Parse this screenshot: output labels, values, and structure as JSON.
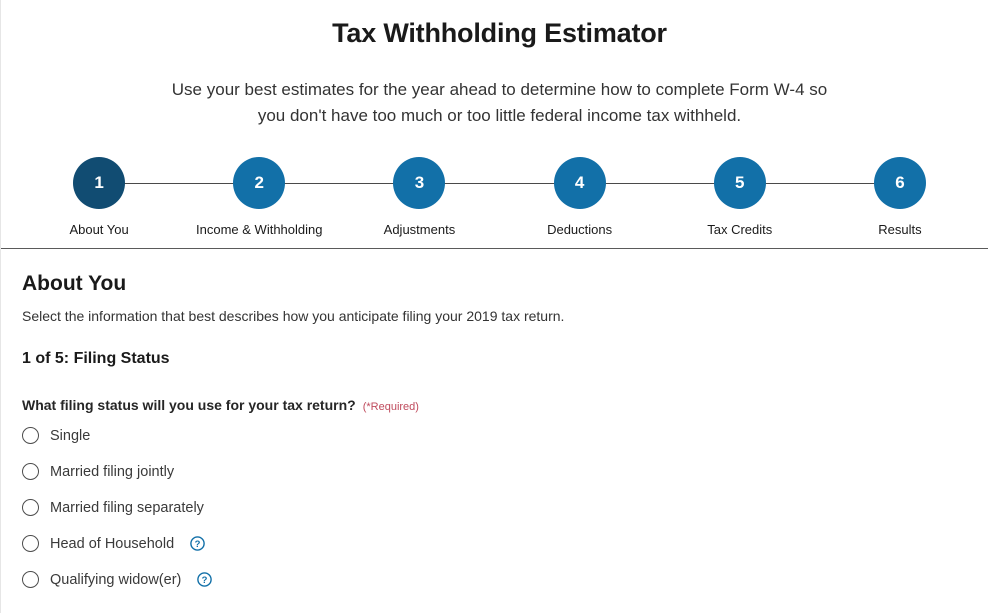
{
  "header": {
    "title": "Tax Withholding Estimator",
    "subtitle": "Use your best estimates for the year ahead to determine how to complete Form W-4 so you don't have too much or too little federal income tax withheld."
  },
  "colors": {
    "step_active": "#114c72",
    "step_inactive": "#1270a8",
    "required_text": "#bf4a5c",
    "help_icon": "#1270a8",
    "connector": "#4a4a4a"
  },
  "stepper": {
    "steps": [
      {
        "number": "1",
        "label": "About You",
        "active": true
      },
      {
        "number": "2",
        "label": "Income & Withholding",
        "active": false
      },
      {
        "number": "3",
        "label": "Adjustments",
        "active": false
      },
      {
        "number": "4",
        "label": "Deductions",
        "active": false
      },
      {
        "number": "5",
        "label": "Tax Credits",
        "active": false
      },
      {
        "number": "6",
        "label": "Results",
        "active": false
      }
    ]
  },
  "section": {
    "title": "About You",
    "description": "Select the information that best describes how you anticipate filing your 2019 tax return.",
    "step_heading": "1 of 5: Filing Status",
    "question": "What filing status will you use for your tax return?",
    "required_tag": "(*Required)",
    "options": [
      {
        "label": "Single",
        "has_help": false,
        "selected": false
      },
      {
        "label": "Married filing jointly",
        "has_help": false,
        "selected": false
      },
      {
        "label": "Married filing separately",
        "has_help": false,
        "selected": false
      },
      {
        "label": "Head of Household",
        "has_help": true,
        "selected": false
      },
      {
        "label": "Qualifying widow(er)",
        "has_help": true,
        "selected": false
      }
    ]
  },
  "icons": {
    "help": "help-question-circle-icon"
  }
}
